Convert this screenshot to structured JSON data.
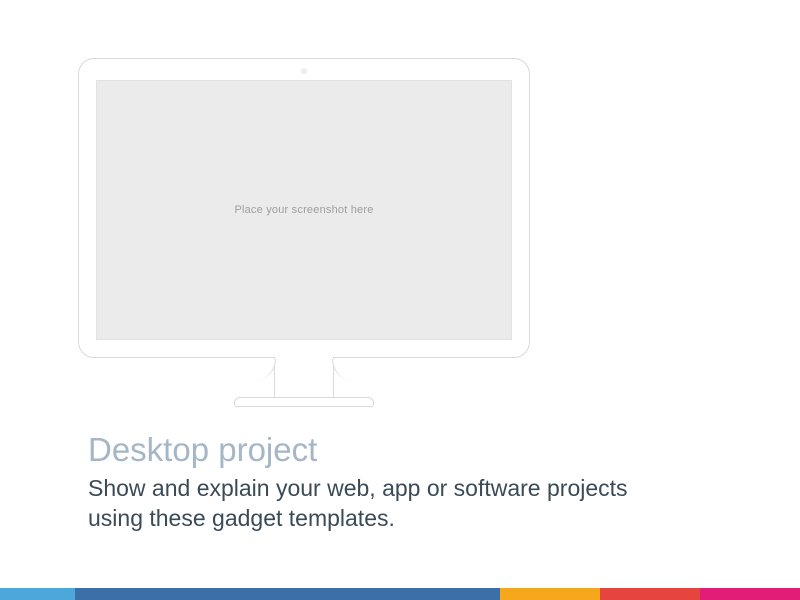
{
  "monitor": {
    "placeholder": "Place your screenshot here"
  },
  "content": {
    "title": "Desktop project",
    "subtitle": "Show and explain your web, app or software projects using these gadget templates."
  },
  "footer_colors": [
    "#4ba8d8",
    "#3a6fa8",
    "#f6a71c",
    "#e6453e",
    "#e21d77"
  ]
}
